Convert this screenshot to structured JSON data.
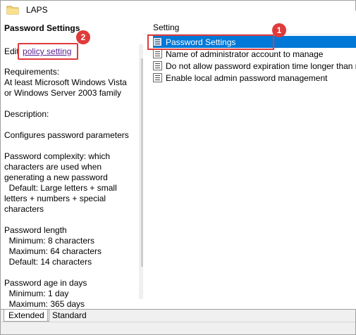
{
  "window": {
    "title": "LAPS"
  },
  "left_pane": {
    "title": "Password Settings",
    "edit_prefix": "Edit",
    "edit_link": "policy setting",
    "description": "Requirements:\nAt least Microsoft Windows Vista or Windows Server 2003 family\n\nDescription:\n\nConfigures password parameters\n\nPassword complexity: which characters are used when generating a new password\n  Default: Large letters + small letters + numbers + special characters\n\nPassword length\n  Minimum: 8 characters\n  Maximum: 64 characters\n  Default: 14 characters\n\nPassword age in days\n  Minimum: 1 day\n  Maximum: 365 days"
  },
  "right_pane": {
    "column_header": "Setting",
    "items": [
      {
        "label": "Password Settings",
        "selected": true
      },
      {
        "label": "Name of administrator account to manage",
        "selected": false
      },
      {
        "label": "Do not allow password expiration time longer than required by policy",
        "selected": false
      },
      {
        "label": "Enable local admin password management",
        "selected": false
      }
    ]
  },
  "badges": {
    "first": "1",
    "second": "2"
  },
  "tabs": [
    {
      "label": "Extended",
      "active": true
    },
    {
      "label": "Standard",
      "active": false
    }
  ],
  "colors": {
    "selection": "#0078d7",
    "annotation": "#e03a3a",
    "link": "#5a1f8f"
  },
  "icons": {
    "title": "folder-icon",
    "item": "policy-setting-icon"
  }
}
